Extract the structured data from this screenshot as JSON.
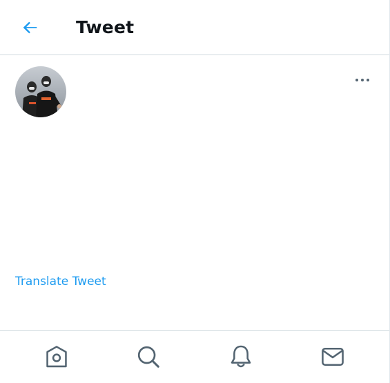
{
  "header": {
    "title": "Tweet",
    "back_icon": "arrow-left-icon"
  },
  "tweet": {
    "avatar_icon": "profile-photo",
    "more_icon": "more-options-icon",
    "translate_label": "Translate Tweet"
  },
  "bottom_nav": {
    "items": [
      {
        "icon": "home-icon"
      },
      {
        "icon": "search-icon"
      },
      {
        "icon": "bell-icon"
      },
      {
        "icon": "mail-icon"
      }
    ]
  },
  "colors": {
    "accent": "#1d9bf0",
    "text": "#0f1419",
    "muted": "#536471",
    "border": "#cfd9de"
  }
}
